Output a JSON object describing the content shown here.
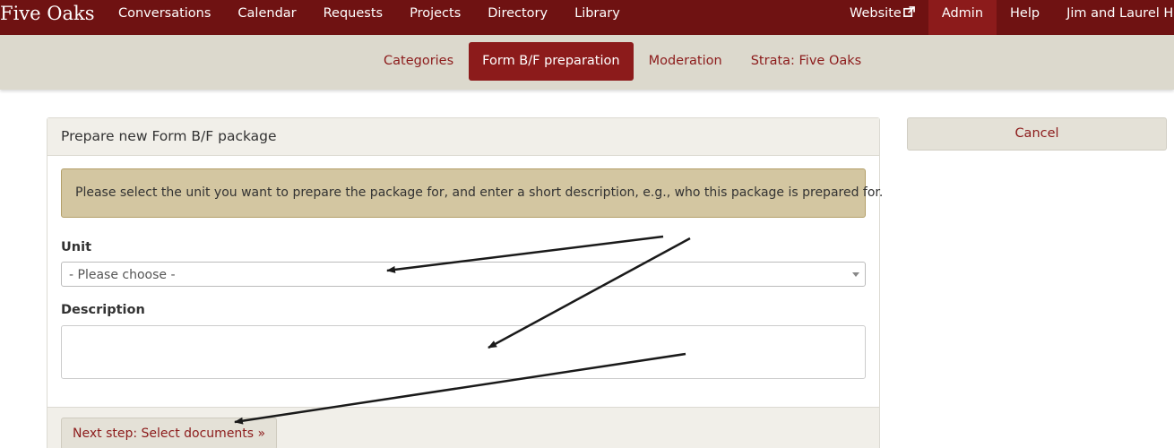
{
  "brand": "Five Oaks",
  "nav": {
    "left": [
      "Conversations",
      "Calendar",
      "Requests",
      "Projects",
      "Directory",
      "Library"
    ],
    "website": "Website",
    "admin": "Admin",
    "help": "Help",
    "user": "Jim and Laurel Hoo"
  },
  "subnav": {
    "categories": "Categories",
    "form_bf": "Form B/F preparation",
    "moderation": "Moderation",
    "strata": "Strata: Five Oaks"
  },
  "panel": {
    "heading": "Prepare new Form B/F package",
    "alert": "Please select the unit you want to prepare the package for, and enter a short description, e.g., who this package is prepared for.",
    "unit_label": "Unit",
    "unit_value": "- Please choose -",
    "description_label": "Description",
    "description_value": "",
    "next_button": "Next step: Select documents »"
  },
  "cancel_button": "Cancel",
  "colors": {
    "navbar": "#6f1212",
    "accent": "#8c1b1b",
    "subbar": "#dcd9cd",
    "alert": "#d3c6a1"
  },
  "icons": [
    "external-link-icon",
    "chevron-down-icon",
    "annotation-arrow"
  ]
}
